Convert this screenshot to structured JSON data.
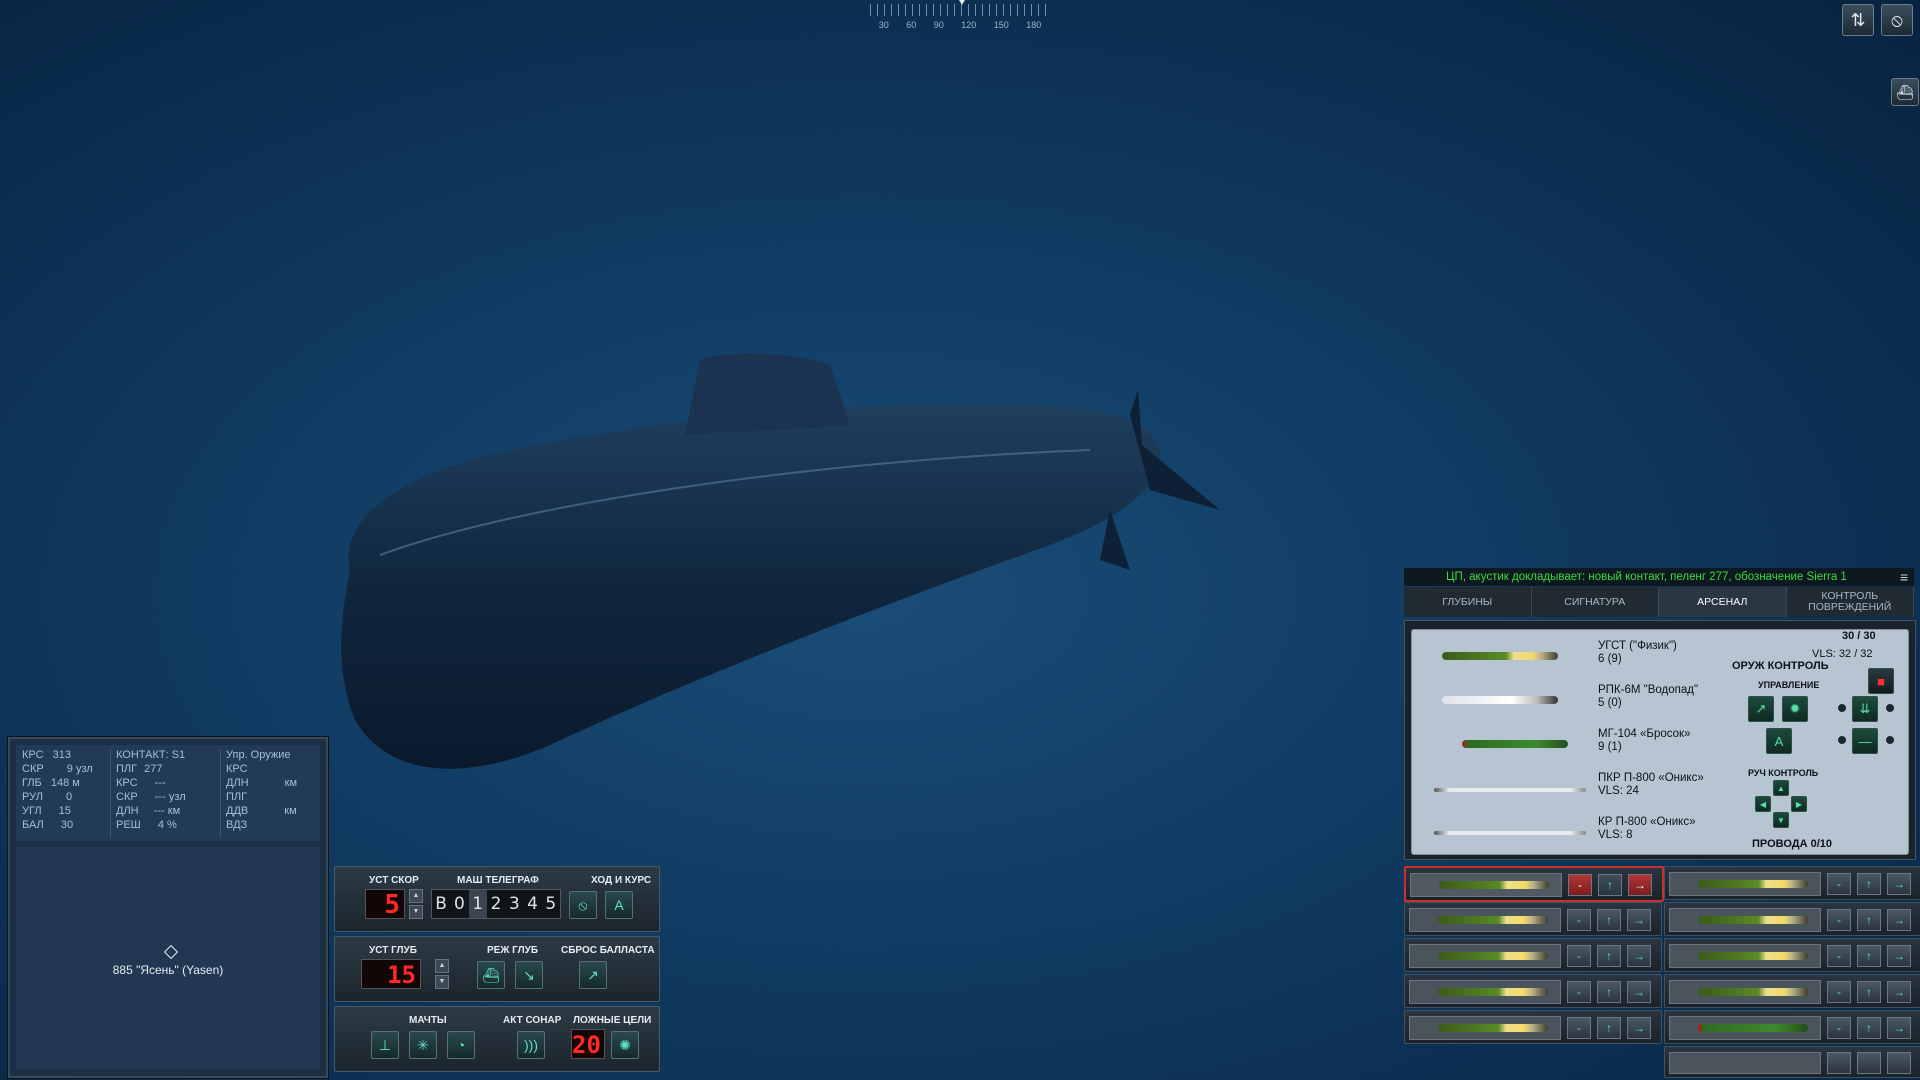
{
  "compass": {
    "ticks": [
      "30",
      "60",
      "90",
      "120",
      "150",
      "180"
    ]
  },
  "top_right": {
    "layers_icon": "layers-icon",
    "cancel_icon": "cancel-icon",
    "ship_icon": "ship-icon"
  },
  "info_panel": {
    "own": [
      {
        "k": "КРС",
        "v": "313",
        "u": ""
      },
      {
        "k": "СКР",
        "v": "9",
        "u": "узл"
      },
      {
        "k": "ГЛБ",
        "v": "148",
        "u": "м"
      },
      {
        "k": "РУЛ",
        "v": "0",
        "u": ""
      },
      {
        "k": "УГЛ",
        "v": "15",
        "u": ""
      },
      {
        "k": "БАЛ",
        "v": "30",
        "u": ""
      }
    ],
    "contact_header": "КОНТАКТ: S1",
    "contact": [
      {
        "k": "ПЛГ",
        "v": "277",
        "u": ""
      },
      {
        "k": "КРС",
        "v": "---",
        "u": ""
      },
      {
        "k": "СКР",
        "v": "---",
        "u": "узл"
      },
      {
        "k": "ДЛН",
        "v": "---",
        "u": "км"
      },
      {
        "k": "РЕШ",
        "v": "4",
        "u": "%"
      }
    ],
    "weapon_header": "Упр. Оружие",
    "weapon": [
      {
        "k": "КРС",
        "u": ""
      },
      {
        "k": "ДЛН",
        "u": "км"
      },
      {
        "k": "ПЛГ",
        "u": ""
      },
      {
        "k": "ДДВ",
        "u": "км"
      },
      {
        "k": "ВДЗ",
        "u": ""
      }
    ],
    "map_label": "885 \"Ясень\" (Yasen)"
  },
  "controls": {
    "speed_title": "УСТ СКОР",
    "speed_value": "5",
    "telegraph_title": "МАШ ТЕЛЕГРАФ",
    "telegraph": [
      "В",
      "0",
      "1",
      "2",
      "3",
      "4",
      "5"
    ],
    "telegraph_selected": 2,
    "course_title": "ХОД И КУРС",
    "depth_title": "УСТ ГЛУБ",
    "depth_value": "15",
    "depth_mode_title": "РЕЖ ГЛУБ",
    "ballast_title": "СБРОС БАЛЛАСТА",
    "masts_title": "МАЧТЫ",
    "sonar_title": "АКТ СОНАР",
    "decoys_title": "ЛОЖНЫЕ ЦЕЛИ",
    "decoys_value": "20"
  },
  "message": {
    "text": "ЦП, акустик докладывает: новый контакт, пеленг 277, обозначение Sierra 1"
  },
  "tabs": [
    "ГЛУБИНЫ",
    "СИГНАТУРА",
    "АРСЕНАЛ",
    "КОНТРОЛЬ ПОВРЕЖДЕНИЙ"
  ],
  "active_tab": 2,
  "arsenal": {
    "weapons": [
      {
        "name": "УГСТ (\"Физик\")",
        "count": "6 (9)"
      },
      {
        "name": "РПК-6М \"Водопад\"",
        "count": "5 (0)"
      },
      {
        "name": "МГ-104 «Бросок»",
        "count": "9 (1)"
      },
      {
        "name": "ПКР П-800 «Оникс»",
        "count": "VLS: 24"
      },
      {
        "name": "КР П-800 «Оникс»",
        "count": "VLS: 8"
      }
    ],
    "torpedo_count": "30 / 30",
    "vls_count": "VLS: 32 / 32",
    "control_title": "ОРУЖ КОНТРОЛЬ",
    "steering_title": "УПРАВЛЕНИЕ",
    "manual_title": "РУЧ КОНТРОЛЬ",
    "wires": "ПРОВОДА 0/10"
  },
  "colors": {
    "water": "#123e66",
    "lcd_red": "#ff2a25",
    "message_green": "#3cdc3c",
    "accent_teal": "#5fe0c6"
  }
}
